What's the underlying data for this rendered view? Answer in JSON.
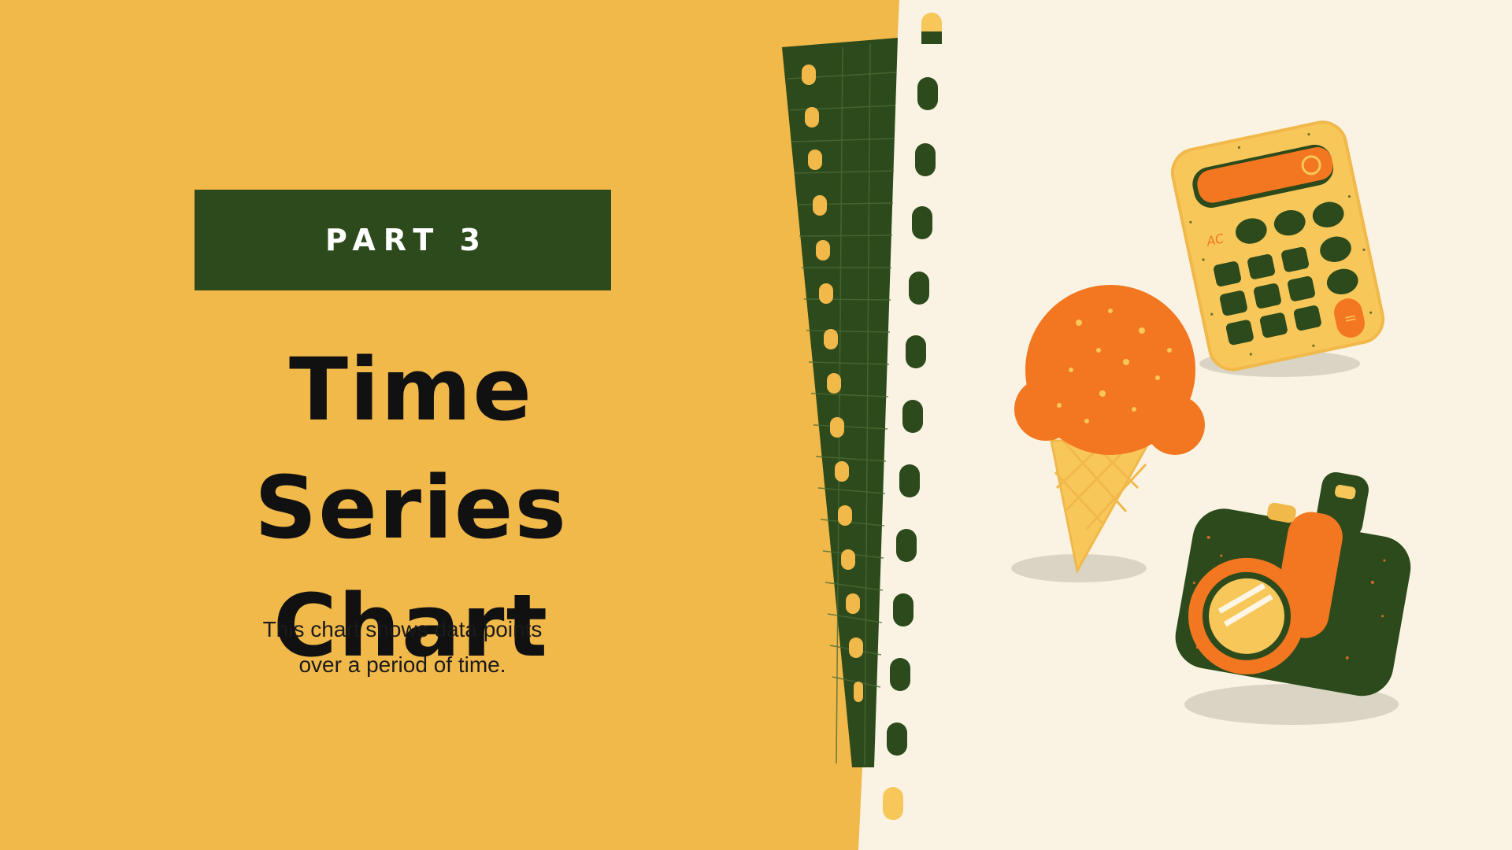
{
  "badge": {
    "label": "PART 3"
  },
  "title": {
    "line1": "Time Series",
    "line2": "Chart"
  },
  "subtitle": {
    "line1": "This chart shows data points",
    "line2": "over a period of time."
  },
  "calculator": {
    "key_label": "AC",
    "equals_label": "="
  },
  "colors": {
    "background_yellow": "#f1b84a",
    "paper_cream": "#faf3e3",
    "dark_green": "#2c4a1b",
    "orange": "#f37720",
    "light_yellow": "#f8c75a"
  },
  "icons": [
    "calculator-icon",
    "ice-cream-icon",
    "camera-icon"
  ]
}
